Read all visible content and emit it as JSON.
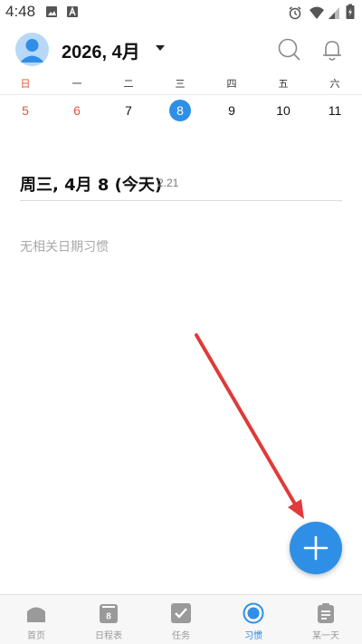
{
  "status_bar": {
    "time": "4:48"
  },
  "header": {
    "title": "2026, 4月"
  },
  "week": {
    "weekdays": [
      "日",
      "一",
      "二",
      "三",
      "四",
      "五",
      "六"
    ],
    "dates": [
      "5",
      "6",
      "7",
      "8",
      "9",
      "10",
      "11"
    ],
    "selected_index": 3
  },
  "day": {
    "heading": "周三, 4月 8 (今天)",
    "score": "2.21",
    "empty_text": "无相关日期习惯"
  },
  "bottom_nav": {
    "items": [
      {
        "label": "首页",
        "icon": "home-icon"
      },
      {
        "label": "日程表",
        "icon": "calendar-icon",
        "icon_text": "8"
      },
      {
        "label": "任务",
        "icon": "task-check-icon"
      },
      {
        "label": "习惯",
        "icon": "habit-target-icon",
        "active": true
      },
      {
        "label": "某一天",
        "icon": "clipboard-icon"
      }
    ]
  },
  "colors": {
    "accent": "#2f8fe6",
    "weekend_red": "#e5533a",
    "annotation_arrow": "#e03a3a"
  }
}
